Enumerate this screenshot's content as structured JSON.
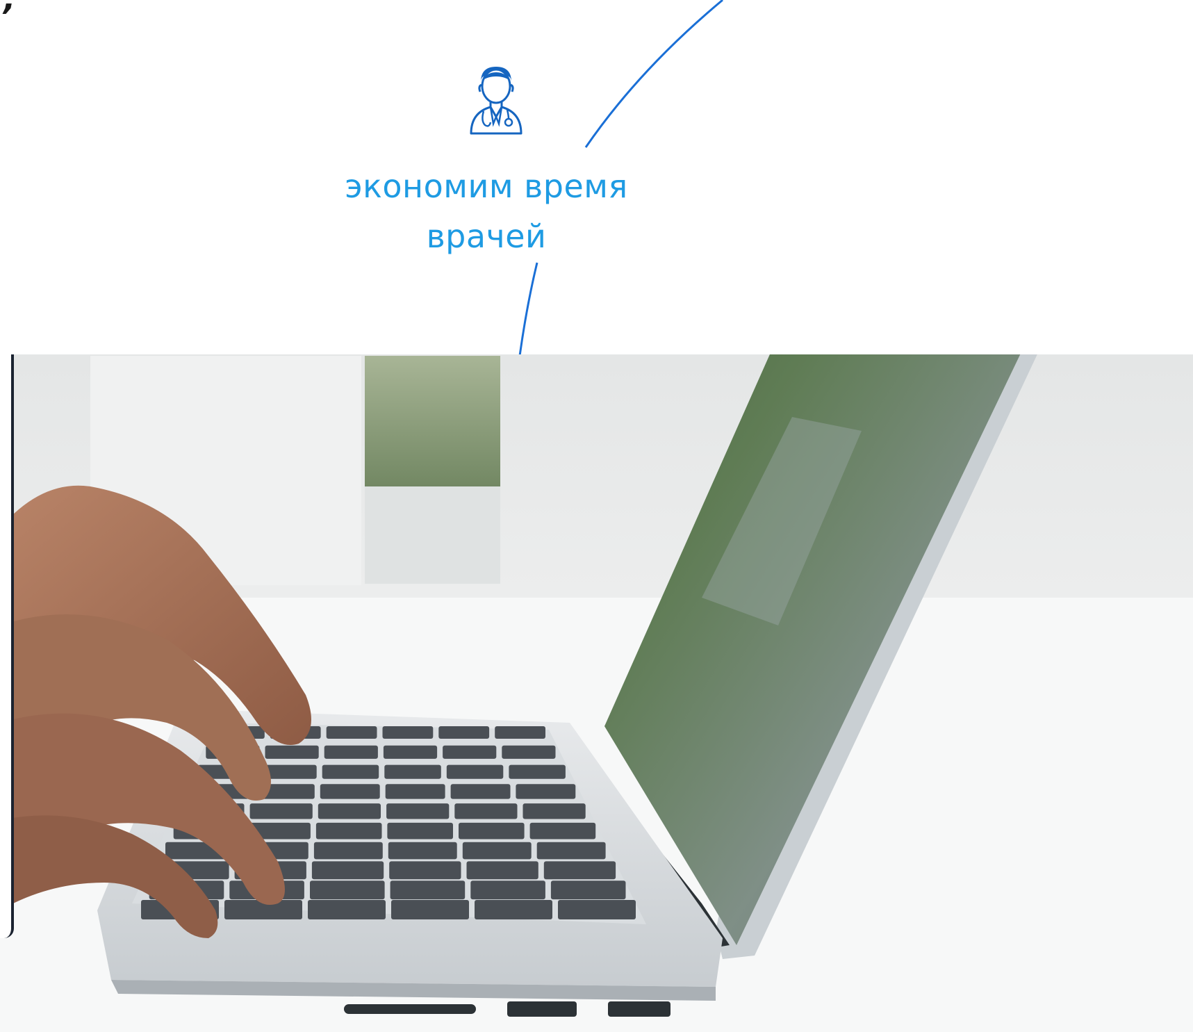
{
  "header": {
    "stray_mark": "’"
  },
  "benefit": {
    "icon": "doctor-icon",
    "line1": "экономим время",
    "line2": "врачей"
  },
  "colors": {
    "accent_text": "#1e9be3",
    "accent_line": "#1a6fd6",
    "icon_blue": "#1565c0"
  },
  "photo": {
    "subject": "hands-typing-on-laptop"
  }
}
